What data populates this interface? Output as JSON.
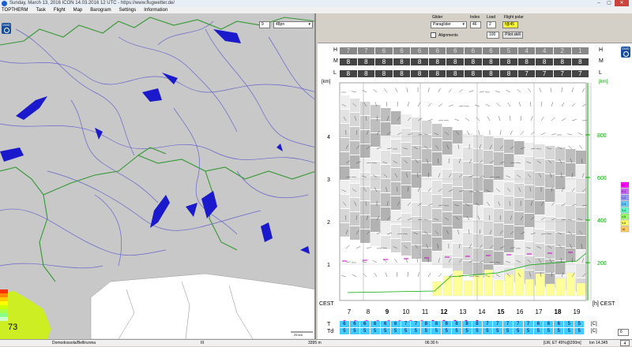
{
  "window": {
    "title": "Sunday, March 13, 2016 ICON 14.03.2016 12 UTC - https://www.flugwetter.de/",
    "min": "–",
    "max": "▢",
    "close": "✕"
  },
  "menu": [
    "TOPTHERM",
    "Task",
    "Flight",
    "Map",
    "Barogram",
    "Settings",
    "Information"
  ],
  "map": {
    "zoom_value": "9",
    "layer_select": "48pn",
    "scale_label": "25 km",
    "legend_value": "73",
    "legend_levels": [
      "500",
      "400",
      "300",
      "250",
      "200",
      "150",
      "100",
      "50"
    ],
    "legend_colors": [
      "#ff3300",
      "#ff8800",
      "#ffcc00",
      "#ffff00",
      "#ccff00",
      "#aaff44",
      "#88ff88",
      "#ccffcc"
    ]
  },
  "controls": {
    "glider_label": "Glider",
    "glider_value": "Paraglider",
    "index_label": "Index",
    "index_value": "46",
    "load_label": "Load",
    "load_value": "2",
    "polar_label": "Flight polar",
    "polar_value": "f@45",
    "alignments_label": "Alignments",
    "pilot_value": "100",
    "pilot_skill_label": "Pilot skill"
  },
  "cloud_rows": {
    "H_label": "H",
    "M_label": "M",
    "L_label": "L",
    "H": [
      "7",
      "7",
      "6",
      "6",
      "6",
      "6",
      "6",
      "6",
      "6",
      "5",
      "4",
      "4",
      "2",
      "1"
    ],
    "M": [
      "8",
      "8",
      "8",
      "8",
      "8",
      "8",
      "8",
      "8",
      "8",
      "8",
      "8",
      "8",
      "8",
      "8"
    ],
    "L": [
      "8",
      "8",
      "8",
      "8",
      "8",
      "8",
      "8",
      "8",
      "8",
      "8",
      "7",
      "7",
      "7",
      "7"
    ]
  },
  "profile": {
    "km_axis_label": "[km]",
    "km_ticks": [
      "4",
      "3",
      "2",
      "1"
    ],
    "hpa_axis_label": "[km]",
    "hpa_ticks": [
      "800",
      "600",
      "400",
      "200"
    ],
    "time_label": "CEST",
    "time_right_label": "[h] CEST",
    "hours": [
      "7",
      "8",
      "9",
      "10",
      "11",
      "12",
      "13",
      "14",
      "15",
      "16",
      "17",
      "18",
      "19"
    ],
    "bold_hours": [
      "9",
      "12",
      "15",
      "18"
    ],
    "T_label": "T",
    "Td_label": "Td",
    "unit_c": "[C]",
    "T_values": [
      "6",
      "6",
      "6",
      "6",
      "6",
      "6",
      "7",
      "7",
      "8",
      "8",
      "8",
      "8",
      "8",
      "8",
      "7",
      "7",
      "7",
      "7",
      "7",
      "6",
      "6",
      "6",
      "5",
      "5"
    ],
    "Td_values": [
      "5",
      "5",
      "5",
      "5",
      "5",
      "5",
      "5",
      "5",
      "5",
      "5",
      "5",
      "5",
      "5",
      "5",
      "5",
      "5",
      "5",
      "5",
      "5",
      "5",
      "5",
      "5",
      "5",
      "5"
    ],
    "right_legend": [
      "<1",
      "0-1",
      "1-2",
      "2-3",
      "3-4",
      "4-5",
      "5-6",
      ">6"
    ],
    "right_legend_colors": [
      "#ff00ff",
      "#cc66ff",
      "#9999ff",
      "#66ccff",
      "#66ffcc",
      "#99ff66",
      "#ffff66",
      "#ffcc66"
    ],
    "bottom_box": "6"
  },
  "status": {
    "location": "Domodossola/Bellinzona",
    "mid": "III",
    "elevation": "3395 m",
    "time": "06:30 h",
    "polar_info": "[LW, ET  45%@200m]",
    "coords": "lon 14.345",
    "right_box": "4"
  }
}
